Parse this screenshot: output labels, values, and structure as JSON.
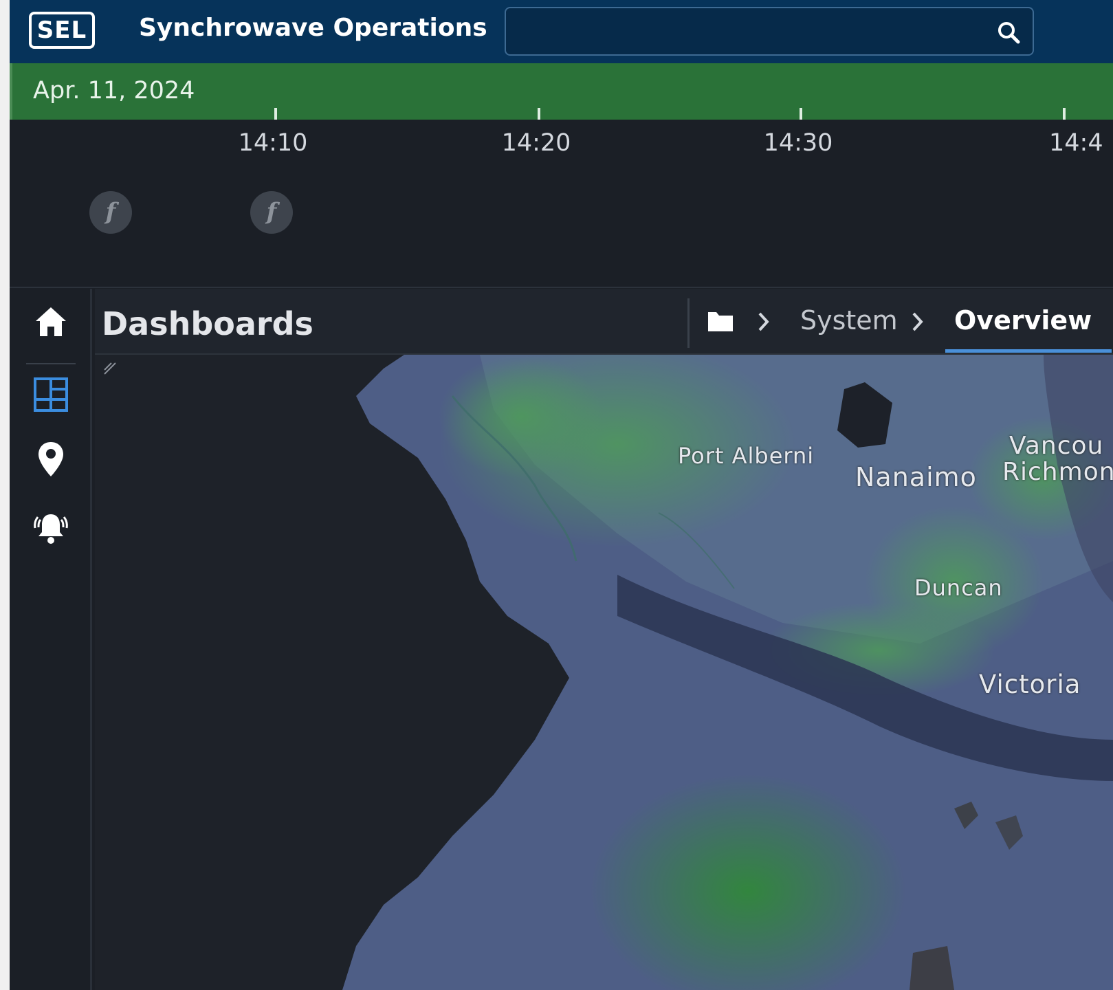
{
  "header": {
    "logo": "SEL",
    "app_title": "Synchrowave Operations",
    "search": {
      "value": "",
      "placeholder": ""
    },
    "search_icon": "search-icon"
  },
  "timeline": {
    "date": "Apr. 11, 2024",
    "ticks": [
      "14:10",
      "14:20",
      "14:30",
      "14:4"
    ],
    "events": [
      {
        "icon": "frequency-event-icon",
        "glyph": "f"
      },
      {
        "icon": "frequency-event-icon",
        "glyph": "f"
      }
    ]
  },
  "sidenav": {
    "items": [
      {
        "name": "home",
        "icon": "home-icon",
        "active": false
      },
      {
        "name": "dashboards",
        "icon": "dashboard-grid-icon",
        "active": true
      },
      {
        "name": "locations",
        "icon": "map-pin-icon",
        "active": false
      },
      {
        "name": "alarms",
        "icon": "alarm-bell-icon",
        "active": false
      }
    ]
  },
  "dashboard": {
    "title": "Dashboards",
    "breadcrumb": {
      "folder_icon": "folder-icon",
      "separator": ">",
      "items": [
        "System",
        "Overview"
      ],
      "active": "Overview"
    }
  },
  "map": {
    "labels": [
      "Port Alberni",
      "Nanaimo",
      "Vancou",
      "Richmon",
      "Duncan",
      "Victoria"
    ]
  },
  "colors": {
    "header_bg": "#06335a",
    "date_band": "#2a7238",
    "accent_blue": "#4a90d9",
    "background": "#1b1f26"
  }
}
